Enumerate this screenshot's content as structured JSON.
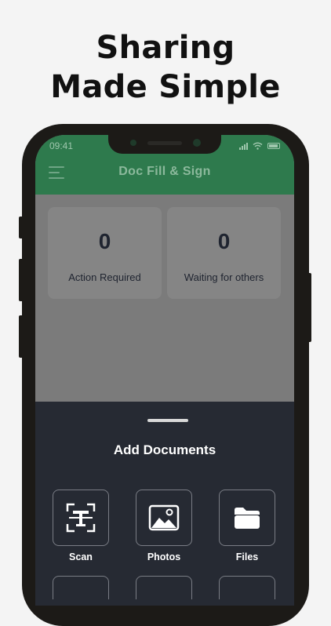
{
  "headline": {
    "line1": "Sharing",
    "line2": "Made Simple"
  },
  "status_bar": {
    "time": "09:41"
  },
  "app_bar": {
    "title": "Doc Fill & Sign",
    "menu_icon": "hamburger-menu-icon"
  },
  "stats": [
    {
      "count": "0",
      "label": "Action Required"
    },
    {
      "count": "0",
      "label": "Waiting for others"
    }
  ],
  "sheet": {
    "title": "Add Documents",
    "options": [
      {
        "label": "Scan",
        "icon": "scan-icon"
      },
      {
        "label": "Photos",
        "icon": "photos-icon"
      },
      {
        "label": "Files",
        "icon": "folder-icon"
      }
    ]
  },
  "colors": {
    "brand_green": "#2e7a4d",
    "sheet_bg": "#262a33",
    "overlay_gray": "#7b7b7b",
    "page_bg": "#f4f4f4"
  }
}
